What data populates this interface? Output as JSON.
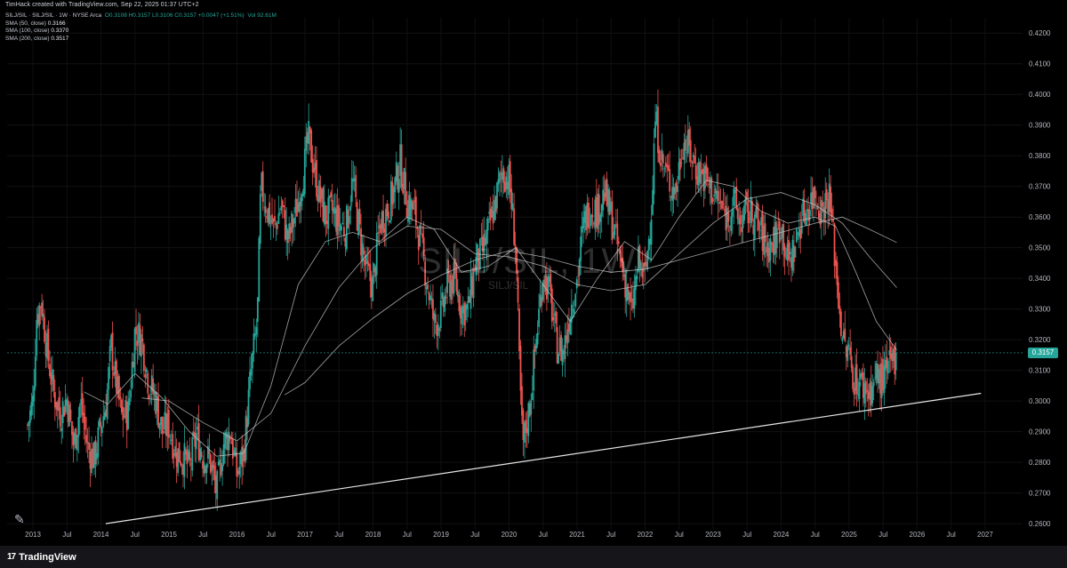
{
  "header": {
    "credit": "TimHack created with TradingView.com, Sep 22, 2025 01:37 UTC+2"
  },
  "legend": {
    "symbol": "SILJ/SIL · SILJ/SIL · 1W · NYSE Arca",
    "ohlc": "O0.3108 H0.3157 L0.3106 C0.3157 +0.0047 (+1.51%)",
    "vol": "Vol 92.61M",
    "sma50": "SMA (50, close)",
    "sma50_val": "0.3166",
    "sma100": "SMA (100, close)",
    "sma100_val": "0.3370",
    "sma200": "SMA (200, close)",
    "sma200_val": "0.3517"
  },
  "watermark": {
    "main": "SILJ/SIL, 1W",
    "sub": "SILJ/SIL"
  },
  "price_label": "0.3157",
  "footer": {
    "brand": "TradingView",
    "logo": "17"
  },
  "colors": {
    "up": "#26a69a",
    "down": "#ef5350",
    "sma": "#c8c8c8",
    "trend": "#e6e6e6",
    "bg": "#000000"
  },
  "icons": {
    "draw": "hand-drawn-trend-icon",
    "logo": "tradingview-logo-icon"
  },
  "chart_data": {
    "type": "candlestick",
    "symbol": "SILJ/SIL",
    "timeframe": "1W",
    "ylim": [
      0.258,
      0.425
    ],
    "y_ticks": [
      "0.2600",
      "0.2700",
      "0.2800",
      "0.2900",
      "0.3000",
      "0.3100",
      "0.3200",
      "0.3300",
      "0.3400",
      "0.3500",
      "0.3600",
      "0.3700",
      "0.3800",
      "0.3900",
      "0.4000",
      "0.4100",
      "0.4200"
    ],
    "x_ticks": [
      {
        "label": "2013",
        "t": 2013.0
      },
      {
        "label": "Jul",
        "t": 2013.5
      },
      {
        "label": "2014",
        "t": 2014.0
      },
      {
        "label": "Jul",
        "t": 2014.5
      },
      {
        "label": "2015",
        "t": 2015.0
      },
      {
        "label": "Jul",
        "t": 2015.5
      },
      {
        "label": "2016",
        "t": 2016.0
      },
      {
        "label": "Jul",
        "t": 2016.5
      },
      {
        "label": "2017",
        "t": 2017.0
      },
      {
        "label": "Jul",
        "t": 2017.5
      },
      {
        "label": "2018",
        "t": 2018.0
      },
      {
        "label": "Jul",
        "t": 2018.5
      },
      {
        "label": "2019",
        "t": 2019.0
      },
      {
        "label": "Jul",
        "t": 2019.5
      },
      {
        "label": "2020",
        "t": 2020.0
      },
      {
        "label": "Jul",
        "t": 2020.5
      },
      {
        "label": "2021",
        "t": 2021.0
      },
      {
        "label": "Jul",
        "t": 2021.5
      },
      {
        "label": "2022",
        "t": 2022.0
      },
      {
        "label": "Jul",
        "t": 2022.5
      },
      {
        "label": "2023",
        "t": 2023.0
      },
      {
        "label": "Jul",
        "t": 2023.5
      },
      {
        "label": "2024",
        "t": 2024.0
      },
      {
        "label": "Jul",
        "t": 2024.5
      },
      {
        "label": "2025",
        "t": 2025.0
      },
      {
        "label": "Jul",
        "t": 2025.5
      },
      {
        "label": "2026",
        "t": 2026.0
      },
      {
        "label": "Jul",
        "t": 2026.5
      },
      {
        "label": "2027",
        "t": 2027.0
      }
    ],
    "xlim": [
      2012.62,
      2027.55
    ],
    "last_close": 0.3157,
    "close_path": [
      [
        2012.92,
        0.292
      ],
      [
        2013.0,
        0.3
      ],
      [
        2013.05,
        0.327
      ],
      [
        2013.12,
        0.333
      ],
      [
        2013.2,
        0.318
      ],
      [
        2013.3,
        0.303
      ],
      [
        2013.4,
        0.296
      ],
      [
        2013.5,
        0.301
      ],
      [
        2013.6,
        0.285
      ],
      [
        2013.7,
        0.3
      ],
      [
        2013.8,
        0.285
      ],
      [
        2013.9,
        0.281
      ],
      [
        2014.0,
        0.292
      ],
      [
        2014.08,
        0.3
      ],
      [
        2014.15,
        0.318
      ],
      [
        2014.2,
        0.309
      ],
      [
        2014.3,
        0.295
      ],
      [
        2014.4,
        0.296
      ],
      [
        2014.5,
        0.323
      ],
      [
        2014.6,
        0.32
      ],
      [
        2014.7,
        0.306
      ],
      [
        2014.8,
        0.301
      ],
      [
        2014.9,
        0.29
      ],
      [
        2015.0,
        0.292
      ],
      [
        2015.1,
        0.283
      ],
      [
        2015.2,
        0.282
      ],
      [
        2015.3,
        0.278
      ],
      [
        2015.4,
        0.289
      ],
      [
        2015.5,
        0.282
      ],
      [
        2015.6,
        0.281
      ],
      [
        2015.7,
        0.27
      ],
      [
        2015.8,
        0.286
      ],
      [
        2015.9,
        0.29
      ],
      [
        2016.0,
        0.276
      ],
      [
        2016.1,
        0.283
      ],
      [
        2016.2,
        0.308
      ],
      [
        2016.3,
        0.327
      ],
      [
        2016.35,
        0.37
      ],
      [
        2016.45,
        0.362
      ],
      [
        2016.55,
        0.356
      ],
      [
        2016.65,
        0.364
      ],
      [
        2016.75,
        0.352
      ],
      [
        2016.9,
        0.365
      ],
      [
        2017.0,
        0.378
      ],
      [
        2017.05,
        0.386
      ],
      [
        2017.1,
        0.38
      ],
      [
        2017.2,
        0.368
      ],
      [
        2017.3,
        0.36
      ],
      [
        2017.4,
        0.362
      ],
      [
        2017.5,
        0.358
      ],
      [
        2017.6,
        0.356
      ],
      [
        2017.7,
        0.372
      ],
      [
        2017.8,
        0.355
      ],
      [
        2017.9,
        0.342
      ],
      [
        2018.0,
        0.338
      ],
      [
        2018.1,
        0.358
      ],
      [
        2018.2,
        0.362
      ],
      [
        2018.3,
        0.368
      ],
      [
        2018.4,
        0.378
      ],
      [
        2018.5,
        0.365
      ],
      [
        2018.6,
        0.362
      ],
      [
        2018.7,
        0.352
      ],
      [
        2018.8,
        0.338
      ],
      [
        2018.9,
        0.325
      ],
      [
        2019.0,
        0.328
      ],
      [
        2019.1,
        0.338
      ],
      [
        2019.2,
        0.34
      ],
      [
        2019.3,
        0.33
      ],
      [
        2019.4,
        0.33
      ],
      [
        2019.5,
        0.345
      ],
      [
        2019.6,
        0.348
      ],
      [
        2019.7,
        0.356
      ],
      [
        2019.8,
        0.365
      ],
      [
        2019.9,
        0.375
      ],
      [
        2020.0,
        0.372
      ],
      [
        2020.1,
        0.35
      ],
      [
        2020.15,
        0.312
      ],
      [
        2020.2,
        0.285
      ],
      [
        2020.3,
        0.298
      ],
      [
        2020.4,
        0.32
      ],
      [
        2020.5,
        0.342
      ],
      [
        2020.6,
        0.335
      ],
      [
        2020.7,
        0.318
      ],
      [
        2020.8,
        0.316
      ],
      [
        2020.9,
        0.33
      ],
      [
        2021.0,
        0.34
      ],
      [
        2021.1,
        0.358
      ],
      [
        2021.2,
        0.364
      ],
      [
        2021.3,
        0.362
      ],
      [
        2021.4,
        0.368
      ],
      [
        2021.5,
        0.36
      ],
      [
        2021.6,
        0.35
      ],
      [
        2021.7,
        0.34
      ],
      [
        2021.8,
        0.328
      ],
      [
        2021.9,
        0.345
      ],
      [
        2022.0,
        0.34
      ],
      [
        2022.1,
        0.365
      ],
      [
        2022.15,
        0.392
      ],
      [
        2022.25,
        0.378
      ],
      [
        2022.35,
        0.372
      ],
      [
        2022.45,
        0.368
      ],
      [
        2022.55,
        0.385
      ],
      [
        2022.65,
        0.382
      ],
      [
        2022.75,
        0.376
      ],
      [
        2022.9,
        0.372
      ],
      [
        2023.0,
        0.368
      ],
      [
        2023.1,
        0.364
      ],
      [
        2023.2,
        0.36
      ],
      [
        2023.3,
        0.365
      ],
      [
        2023.4,
        0.358
      ],
      [
        2023.5,
        0.362
      ],
      [
        2023.6,
        0.36
      ],
      [
        2023.7,
        0.355
      ],
      [
        2023.8,
        0.35
      ],
      [
        2023.9,
        0.352
      ],
      [
        2024.0,
        0.358
      ],
      [
        2024.1,
        0.345
      ],
      [
        2024.2,
        0.35
      ],
      [
        2024.3,
        0.36
      ],
      [
        2024.4,
        0.364
      ],
      [
        2024.5,
        0.368
      ],
      [
        2024.6,
        0.362
      ],
      [
        2024.7,
        0.368
      ],
      [
        2024.75,
        0.358
      ],
      [
        2024.8,
        0.345
      ],
      [
        2024.85,
        0.332
      ],
      [
        2024.92,
        0.318
      ],
      [
        2025.0,
        0.315
      ],
      [
        2025.08,
        0.307
      ],
      [
        2025.2,
        0.305
      ],
      [
        2025.3,
        0.303
      ],
      [
        2025.4,
        0.308
      ],
      [
        2025.5,
        0.307
      ],
      [
        2025.6,
        0.311
      ],
      [
        2025.7,
        0.3157
      ]
    ],
    "sma_paths": [
      {
        "name": "SMA (50, close)",
        "points": [
          [
            2013.75,
            0.303
          ],
          [
            2014.1,
            0.299
          ],
          [
            2014.5,
            0.309
          ],
          [
            2014.9,
            0.301
          ],
          [
            2015.3,
            0.29
          ],
          [
            2015.7,
            0.282
          ],
          [
            2016.1,
            0.283
          ],
          [
            2016.5,
            0.305
          ],
          [
            2016.9,
            0.338
          ],
          [
            2017.3,
            0.352
          ],
          [
            2017.7,
            0.355
          ],
          [
            2018.1,
            0.352
          ],
          [
            2018.5,
            0.36
          ],
          [
            2018.9,
            0.356
          ],
          [
            2019.3,
            0.342
          ],
          [
            2019.7,
            0.344
          ],
          [
            2020.1,
            0.35
          ],
          [
            2020.5,
            0.338
          ],
          [
            2020.9,
            0.326
          ],
          [
            2021.3,
            0.34
          ],
          [
            2021.7,
            0.352
          ],
          [
            2022.1,
            0.346
          ],
          [
            2022.5,
            0.36
          ],
          [
            2022.9,
            0.372
          ],
          [
            2023.3,
            0.37
          ],
          [
            2023.7,
            0.362
          ],
          [
            2024.1,
            0.358
          ],
          [
            2024.5,
            0.36
          ],
          [
            2024.8,
            0.357
          ],
          [
            2025.1,
            0.342
          ],
          [
            2025.4,
            0.326
          ],
          [
            2025.7,
            0.3166
          ]
        ]
      },
      {
        "name": "SMA (100, close)",
        "points": [
          [
            2014.6,
            0.301
          ],
          [
            2015.0,
            0.3
          ],
          [
            2015.5,
            0.293
          ],
          [
            2016.0,
            0.287
          ],
          [
            2016.5,
            0.296
          ],
          [
            2017.0,
            0.318
          ],
          [
            2017.5,
            0.337
          ],
          [
            2018.0,
            0.35
          ],
          [
            2018.5,
            0.357
          ],
          [
            2019.0,
            0.356
          ],
          [
            2019.5,
            0.348
          ],
          [
            2020.0,
            0.347
          ],
          [
            2020.5,
            0.344
          ],
          [
            2021.0,
            0.338
          ],
          [
            2021.5,
            0.336
          ],
          [
            2022.0,
            0.338
          ],
          [
            2022.5,
            0.348
          ],
          [
            2023.0,
            0.358
          ],
          [
            2023.5,
            0.366
          ],
          [
            2024.0,
            0.368
          ],
          [
            2024.5,
            0.364
          ],
          [
            2024.9,
            0.358
          ],
          [
            2025.3,
            0.347
          ],
          [
            2025.7,
            0.337
          ]
        ]
      },
      {
        "name": "SMA (200, close)",
        "points": [
          [
            2016.7,
            0.302
          ],
          [
            2017.0,
            0.306
          ],
          [
            2017.5,
            0.318
          ],
          [
            2018.0,
            0.327
          ],
          [
            2018.5,
            0.335
          ],
          [
            2019.0,
            0.341
          ],
          [
            2019.5,
            0.346
          ],
          [
            2020.0,
            0.349
          ],
          [
            2020.5,
            0.347
          ],
          [
            2021.0,
            0.344
          ],
          [
            2021.5,
            0.342
          ],
          [
            2022.0,
            0.343
          ],
          [
            2022.5,
            0.346
          ],
          [
            2023.0,
            0.349
          ],
          [
            2023.5,
            0.352
          ],
          [
            2024.0,
            0.355
          ],
          [
            2024.5,
            0.358
          ],
          [
            2024.9,
            0.36
          ],
          [
            2025.3,
            0.356
          ],
          [
            2025.7,
            0.3517
          ]
        ]
      }
    ],
    "trendline": [
      [
        2014.07,
        0.26
      ],
      [
        2026.94,
        0.3025
      ]
    ],
    "current_price_line": 0.3157
  }
}
